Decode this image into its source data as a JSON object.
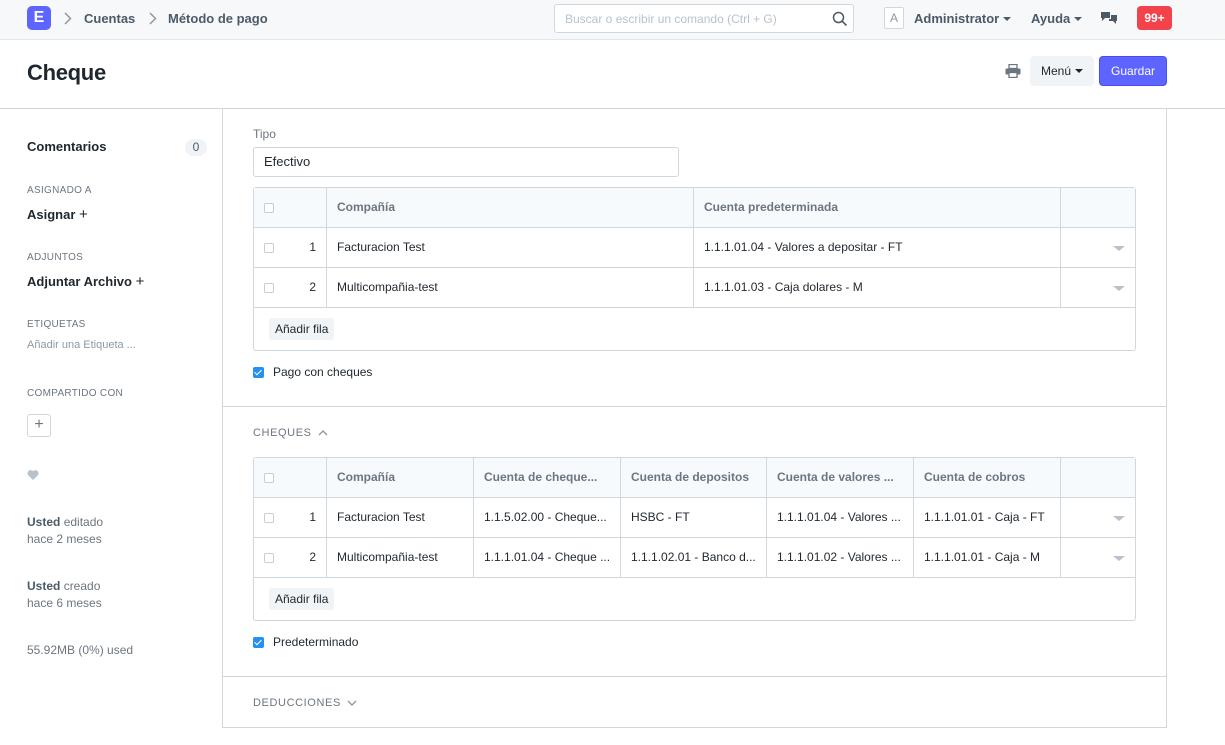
{
  "navbar": {
    "logo": "E",
    "breadcrumbs": [
      "Cuentas",
      "Método de pago"
    ],
    "search_placeholder": "Buscar o escribir un comando (Ctrl + G)",
    "avatar_letter": "A",
    "user_menu": "Administrator",
    "help_menu": "Ayuda",
    "notifications": "99+"
  },
  "page": {
    "title": "Cheque",
    "menu_button": "Menú",
    "save_button": "Guardar"
  },
  "sidebar": {
    "comments_label": "Comentarios",
    "comments_count": "0",
    "assigned_label": "ASIGNADO A",
    "assign_action": "Asignar",
    "attachments_label": "ADJUNTOS",
    "attach_action": "Adjuntar Archivo",
    "tags_label": "ETIQUETAS",
    "tags_placeholder": "Añadir una Etiqueta ...",
    "shared_label": "COMPARTIDO CON",
    "activity": [
      {
        "user": "Usted",
        "action": "editado",
        "when": "hace 2 meses"
      },
      {
        "user": "Usted",
        "action": "creado",
        "when": "hace 6 meses"
      }
    ],
    "storage": "55.92MB (0%) used"
  },
  "form": {
    "tipo_label": "Tipo",
    "tipo_value": "Efectivo",
    "accounts_table": {
      "headers": [
        "Compañía",
        "Cuenta predeterminada"
      ],
      "rows": [
        {
          "idx": "1",
          "company": "Facturacion Test",
          "account": "1.1.1.01.04 - Valores a depositar - FT"
        },
        {
          "idx": "2",
          "company": "Multicompañia-test",
          "account": "1.1.1.01.03 - Caja dolares - M"
        }
      ],
      "add_row": "Añadir fila"
    },
    "pago_con_cheques": "Pago con cheques",
    "cheques_section": "CHEQUES",
    "cheques_table": {
      "headers": [
        "Compañía",
        "Cuenta de cheque...",
        "Cuenta de depositos",
        "Cuenta de valores ...",
        "Cuenta de cobros"
      ],
      "rows": [
        {
          "idx": "1",
          "company": "Facturacion Test",
          "c1": "1.1.5.02.00 - Cheque...",
          "c2": "HSBC - FT",
          "c3": "1.1.1.01.04 - Valores ...",
          "c4": "1.1.1.01.01 - Caja - FT"
        },
        {
          "idx": "2",
          "company": "Multicompañia-test",
          "c1": "1.1.1.01.04 - Cheque ...",
          "c2": "1.1.1.02.01 - Banco d...",
          "c3": "1.1.1.01.02 - Valores ...",
          "c4": "1.1.1.01.01 - Caja - M"
        }
      ],
      "add_row": "Añadir fila"
    },
    "predeterminado": "Predeterminado",
    "deducciones_section": "DEDUCCIONES"
  }
}
